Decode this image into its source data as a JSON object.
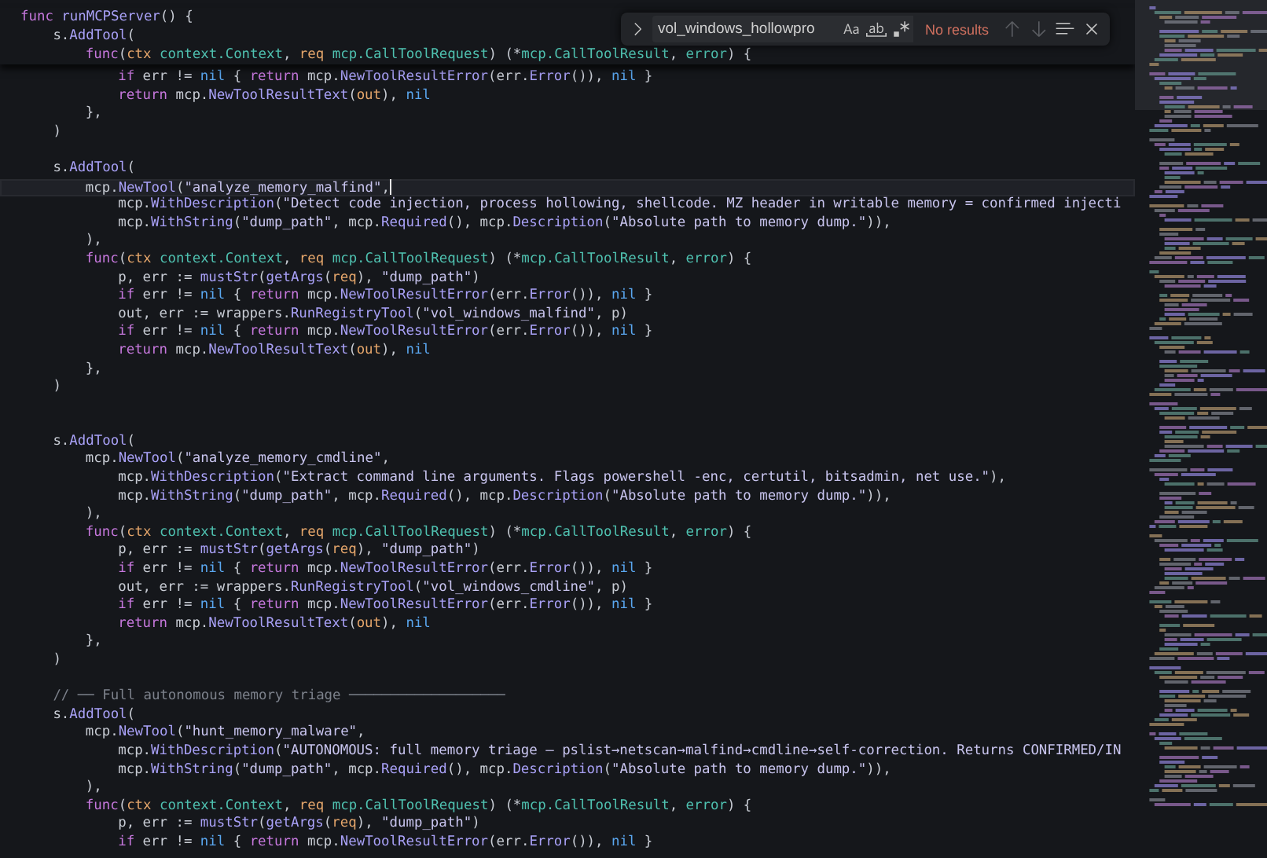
{
  "sticky_lines": [
    {
      "tokens": [
        {
          "kind": "kw",
          "text": "func"
        },
        {
          "kind": "fn",
          "text": " runMCPServer"
        },
        {
          "kind": "plain",
          "text": "() {"
        }
      ]
    },
    {
      "tokens": [
        {
          "kind": "plain",
          "text": "\ts."
        },
        {
          "kind": "fn",
          "text": "AddTool"
        },
        {
          "kind": "plain",
          "text": "("
        }
      ]
    },
    {
      "tokens": [
        {
          "kind": "kw",
          "text": "\t\tfunc"
        },
        {
          "kind": "plain",
          "text": "("
        },
        {
          "kind": "var",
          "text": "ctx"
        },
        {
          "kind": "type",
          "text": " context.Context"
        },
        {
          "kind": "plain",
          "text": ", "
        },
        {
          "kind": "var",
          "text": "req"
        },
        {
          "kind": "type",
          "text": " mcp.CallToolRequest"
        },
        {
          "kind": "plain",
          "text": ") (*"
        },
        {
          "kind": "type",
          "text": "mcp.CallToolResult"
        },
        {
          "kind": "plain",
          "text": ", "
        },
        {
          "kind": "type",
          "text": "error"
        },
        {
          "kind": "plain",
          "text": ") {"
        }
      ]
    }
  ],
  "lines": [
    {
      "current": false,
      "tokens": [
        {
          "kind": "kw",
          "text": "\t\t\tif"
        },
        {
          "kind": "plain",
          "text": " err != "
        },
        {
          "kind": "nil",
          "text": "nil"
        },
        {
          "kind": "plain",
          "text": " { "
        },
        {
          "kind": "kw",
          "text": "return"
        },
        {
          "kind": "plain",
          "text": " mcp."
        },
        {
          "kind": "fn",
          "text": "NewToolResultError"
        },
        {
          "kind": "plain",
          "text": "(err."
        },
        {
          "kind": "fn",
          "text": "Error"
        },
        {
          "kind": "plain",
          "text": "()), "
        },
        {
          "kind": "nil",
          "text": "nil"
        },
        {
          "kind": "plain",
          "text": " }"
        }
      ]
    },
    {
      "current": false,
      "tokens": [
        {
          "kind": "kw",
          "text": "\t\t\treturn"
        },
        {
          "kind": "plain",
          "text": " mcp."
        },
        {
          "kind": "fn",
          "text": "NewToolResultText"
        },
        {
          "kind": "plain",
          "text": "("
        },
        {
          "kind": "var",
          "text": "out"
        },
        {
          "kind": "plain",
          "text": "), "
        },
        {
          "kind": "nil",
          "text": "nil"
        }
      ]
    },
    {
      "current": false,
      "tokens": [
        {
          "kind": "plain",
          "text": "\t\t},"
        }
      ]
    },
    {
      "current": false,
      "tokens": [
        {
          "kind": "plain",
          "text": "\t)"
        }
      ]
    },
    {
      "current": false
    },
    {
      "current": false,
      "tokens": [
        {
          "kind": "plain",
          "text": "\ts."
        },
        {
          "kind": "fn",
          "text": "AddTool"
        },
        {
          "kind": "plain",
          "text": "("
        }
      ]
    },
    {
      "current": true,
      "tokens": [
        {
          "kind": "plain",
          "text": "\t\tmcp."
        },
        {
          "kind": "fn",
          "text": "NewTool"
        },
        {
          "kind": "plain",
          "text": "("
        },
        {
          "kind": "str",
          "text": "\"analyze_memory_malfind\""
        },
        {
          "kind": "plain",
          "text": ","
        }
      ]
    },
    {
      "current": false,
      "tokens": [
        {
          "kind": "plain",
          "text": "\t\t\tmcp."
        },
        {
          "kind": "fn",
          "text": "WithDescription"
        },
        {
          "kind": "plain",
          "text": "("
        },
        {
          "kind": "str",
          "text": "\"Detect code injection, process hollowing, shellcode. MZ header in writable memory = confirmed injecti"
        }
      ]
    },
    {
      "current": false,
      "tokens": [
        {
          "kind": "plain",
          "text": "\t\t\tmcp."
        },
        {
          "kind": "fn",
          "text": "WithString"
        },
        {
          "kind": "plain",
          "text": "("
        },
        {
          "kind": "str",
          "text": "\"dump_path\""
        },
        {
          "kind": "plain",
          "text": ", mcp."
        },
        {
          "kind": "fn",
          "text": "Required"
        },
        {
          "kind": "plain",
          "text": "(), mcp."
        },
        {
          "kind": "fn",
          "text": "Description"
        },
        {
          "kind": "plain",
          "text": "("
        },
        {
          "kind": "str",
          "text": "\"Absolute path to memory dump.\""
        },
        {
          "kind": "plain",
          "text": ")),"
        }
      ]
    },
    {
      "current": false,
      "tokens": [
        {
          "kind": "plain",
          "text": "\t\t),"
        }
      ]
    },
    {
      "current": false,
      "tokens": [
        {
          "kind": "kw",
          "text": "\t\tfunc"
        },
        {
          "kind": "plain",
          "text": "("
        },
        {
          "kind": "var",
          "text": "ctx"
        },
        {
          "kind": "type",
          "text": " context.Context"
        },
        {
          "kind": "plain",
          "text": ", "
        },
        {
          "kind": "var",
          "text": "req"
        },
        {
          "kind": "type",
          "text": " mcp.CallToolRequest"
        },
        {
          "kind": "plain",
          "text": ") (*"
        },
        {
          "kind": "type",
          "text": "mcp.CallToolResult"
        },
        {
          "kind": "plain",
          "text": ", "
        },
        {
          "kind": "type",
          "text": "error"
        },
        {
          "kind": "plain",
          "text": ") {"
        }
      ]
    },
    {
      "current": false,
      "tokens": [
        {
          "kind": "plain",
          "text": "\t\t\tp, err := "
        },
        {
          "kind": "fn",
          "text": "mustStr"
        },
        {
          "kind": "plain",
          "text": "("
        },
        {
          "kind": "fn",
          "text": "getArgs"
        },
        {
          "kind": "plain",
          "text": "("
        },
        {
          "kind": "var",
          "text": "req"
        },
        {
          "kind": "plain",
          "text": "), "
        },
        {
          "kind": "str",
          "text": "\"dump_path\""
        },
        {
          "kind": "plain",
          "text": ")"
        }
      ]
    },
    {
      "current": false,
      "tokens": [
        {
          "kind": "kw",
          "text": "\t\t\tif"
        },
        {
          "kind": "plain",
          "text": " err != "
        },
        {
          "kind": "nil",
          "text": "nil"
        },
        {
          "kind": "plain",
          "text": " { "
        },
        {
          "kind": "kw",
          "text": "return"
        },
        {
          "kind": "plain",
          "text": " mcp."
        },
        {
          "kind": "fn",
          "text": "NewToolResultError"
        },
        {
          "kind": "plain",
          "text": "(err."
        },
        {
          "kind": "fn",
          "text": "Error"
        },
        {
          "kind": "plain",
          "text": "()), "
        },
        {
          "kind": "nil",
          "text": "nil"
        },
        {
          "kind": "plain",
          "text": " }"
        }
      ]
    },
    {
      "current": false,
      "tokens": [
        {
          "kind": "plain",
          "text": "\t\t\tout, err := wrappers."
        },
        {
          "kind": "fn",
          "text": "RunRegistryTool"
        },
        {
          "kind": "plain",
          "text": "("
        },
        {
          "kind": "str",
          "text": "\"vol_windows_malfind\""
        },
        {
          "kind": "plain",
          "text": ", p)"
        }
      ]
    },
    {
      "current": false,
      "tokens": [
        {
          "kind": "kw",
          "text": "\t\t\tif"
        },
        {
          "kind": "plain",
          "text": " err != "
        },
        {
          "kind": "nil",
          "text": "nil"
        },
        {
          "kind": "plain",
          "text": " { "
        },
        {
          "kind": "kw",
          "text": "return"
        },
        {
          "kind": "plain",
          "text": " mcp."
        },
        {
          "kind": "fn",
          "text": "NewToolResultError"
        },
        {
          "kind": "plain",
          "text": "(err."
        },
        {
          "kind": "fn",
          "text": "Error"
        },
        {
          "kind": "plain",
          "text": "()), "
        },
        {
          "kind": "nil",
          "text": "nil"
        },
        {
          "kind": "plain",
          "text": " }"
        }
      ]
    },
    {
      "current": false,
      "tokens": [
        {
          "kind": "kw",
          "text": "\t\t\treturn"
        },
        {
          "kind": "plain",
          "text": " mcp."
        },
        {
          "kind": "fn",
          "text": "NewToolResultText"
        },
        {
          "kind": "plain",
          "text": "("
        },
        {
          "kind": "var",
          "text": "out"
        },
        {
          "kind": "plain",
          "text": "), "
        },
        {
          "kind": "nil",
          "text": "nil"
        }
      ]
    },
    {
      "current": false,
      "tokens": [
        {
          "kind": "plain",
          "text": "\t\t},"
        }
      ]
    },
    {
      "current": false,
      "tokens": [
        {
          "kind": "plain",
          "text": "\t)"
        }
      ]
    },
    {
      "current": false
    },
    {
      "current": false
    },
    {
      "current": false,
      "tokens": [
        {
          "kind": "plain",
          "text": "\ts."
        },
        {
          "kind": "fn",
          "text": "AddTool"
        },
        {
          "kind": "plain",
          "text": "("
        }
      ]
    },
    {
      "current": false,
      "tokens": [
        {
          "kind": "plain",
          "text": "\t\tmcp."
        },
        {
          "kind": "fn",
          "text": "NewTool"
        },
        {
          "kind": "plain",
          "text": "("
        },
        {
          "kind": "str",
          "text": "\"analyze_memory_cmdline\""
        },
        {
          "kind": "plain",
          "text": ","
        }
      ]
    },
    {
      "current": false,
      "tokens": [
        {
          "kind": "plain",
          "text": "\t\t\tmcp."
        },
        {
          "kind": "fn",
          "text": "WithDescription"
        },
        {
          "kind": "plain",
          "text": "("
        },
        {
          "kind": "str",
          "text": "\"Extract command line arguments. Flags powershell -enc, certutil, bitsadmin, net use.\""
        },
        {
          "kind": "plain",
          "text": "),"
        }
      ]
    },
    {
      "current": false,
      "tokens": [
        {
          "kind": "plain",
          "text": "\t\t\tmcp."
        },
        {
          "kind": "fn",
          "text": "WithString"
        },
        {
          "kind": "plain",
          "text": "("
        },
        {
          "kind": "str",
          "text": "\"dump_path\""
        },
        {
          "kind": "plain",
          "text": ", mcp."
        },
        {
          "kind": "fn",
          "text": "Required"
        },
        {
          "kind": "plain",
          "text": "(), mcp."
        },
        {
          "kind": "fn",
          "text": "Description"
        },
        {
          "kind": "plain",
          "text": "("
        },
        {
          "kind": "str",
          "text": "\"Absolute path to memory dump.\""
        },
        {
          "kind": "plain",
          "text": ")),"
        }
      ]
    },
    {
      "current": false,
      "tokens": [
        {
          "kind": "plain",
          "text": "\t\t),"
        }
      ]
    },
    {
      "current": false,
      "tokens": [
        {
          "kind": "kw",
          "text": "\t\tfunc"
        },
        {
          "kind": "plain",
          "text": "("
        },
        {
          "kind": "var",
          "text": "ctx"
        },
        {
          "kind": "type",
          "text": " context.Context"
        },
        {
          "kind": "plain",
          "text": ", "
        },
        {
          "kind": "var",
          "text": "req"
        },
        {
          "kind": "type",
          "text": " mcp.CallToolRequest"
        },
        {
          "kind": "plain",
          "text": ") (*"
        },
        {
          "kind": "type",
          "text": "mcp.CallToolResult"
        },
        {
          "kind": "plain",
          "text": ", "
        },
        {
          "kind": "type",
          "text": "error"
        },
        {
          "kind": "plain",
          "text": ") {"
        }
      ]
    },
    {
      "current": false,
      "tokens": [
        {
          "kind": "plain",
          "text": "\t\t\tp, err := "
        },
        {
          "kind": "fn",
          "text": "mustStr"
        },
        {
          "kind": "plain",
          "text": "("
        },
        {
          "kind": "fn",
          "text": "getArgs"
        },
        {
          "kind": "plain",
          "text": "("
        },
        {
          "kind": "var",
          "text": "req"
        },
        {
          "kind": "plain",
          "text": "), "
        },
        {
          "kind": "str",
          "text": "\"dump_path\""
        },
        {
          "kind": "plain",
          "text": ")"
        }
      ]
    },
    {
      "current": false,
      "tokens": [
        {
          "kind": "kw",
          "text": "\t\t\tif"
        },
        {
          "kind": "plain",
          "text": " err != "
        },
        {
          "kind": "nil",
          "text": "nil"
        },
        {
          "kind": "plain",
          "text": " { "
        },
        {
          "kind": "kw",
          "text": "return"
        },
        {
          "kind": "plain",
          "text": " mcp."
        },
        {
          "kind": "fn",
          "text": "NewToolResultError"
        },
        {
          "kind": "plain",
          "text": "(err."
        },
        {
          "kind": "fn",
          "text": "Error"
        },
        {
          "kind": "plain",
          "text": "()), "
        },
        {
          "kind": "nil",
          "text": "nil"
        },
        {
          "kind": "plain",
          "text": " }"
        }
      ]
    },
    {
      "current": false,
      "tokens": [
        {
          "kind": "plain",
          "text": "\t\t\tout, err := wrappers."
        },
        {
          "kind": "fn",
          "text": "RunRegistryTool"
        },
        {
          "kind": "plain",
          "text": "("
        },
        {
          "kind": "str",
          "text": "\"vol_windows_cmdline\""
        },
        {
          "kind": "plain",
          "text": ", p)"
        }
      ]
    },
    {
      "current": false,
      "tokens": [
        {
          "kind": "kw",
          "text": "\t\t\tif"
        },
        {
          "kind": "plain",
          "text": " err != "
        },
        {
          "kind": "nil",
          "text": "nil"
        },
        {
          "kind": "plain",
          "text": " { "
        },
        {
          "kind": "kw",
          "text": "return"
        },
        {
          "kind": "plain",
          "text": " mcp."
        },
        {
          "kind": "fn",
          "text": "NewToolResultError"
        },
        {
          "kind": "plain",
          "text": "(err."
        },
        {
          "kind": "fn",
          "text": "Error"
        },
        {
          "kind": "plain",
          "text": "()), "
        },
        {
          "kind": "nil",
          "text": "nil"
        },
        {
          "kind": "plain",
          "text": " }"
        }
      ]
    },
    {
      "current": false,
      "tokens": [
        {
          "kind": "kw",
          "text": "\t\t\treturn"
        },
        {
          "kind": "plain",
          "text": " mcp."
        },
        {
          "kind": "fn",
          "text": "NewToolResultText"
        },
        {
          "kind": "plain",
          "text": "("
        },
        {
          "kind": "var",
          "text": "out"
        },
        {
          "kind": "plain",
          "text": "), "
        },
        {
          "kind": "nil",
          "text": "nil"
        }
      ]
    },
    {
      "current": false,
      "tokens": [
        {
          "kind": "plain",
          "text": "\t\t},"
        }
      ]
    },
    {
      "current": false,
      "tokens": [
        {
          "kind": "plain",
          "text": "\t)"
        }
      ]
    },
    {
      "current": false
    },
    {
      "current": false,
      "tokens": [
        {
          "kind": "comment",
          "text": "\t// ── Full autonomous memory triage ───────────────────"
        }
      ]
    },
    {
      "current": false,
      "tokens": [
        {
          "kind": "plain",
          "text": "\ts."
        },
        {
          "kind": "fn",
          "text": "AddTool"
        },
        {
          "kind": "plain",
          "text": "("
        }
      ]
    },
    {
      "current": false,
      "tokens": [
        {
          "kind": "plain",
          "text": "\t\tmcp."
        },
        {
          "kind": "fn",
          "text": "NewTool"
        },
        {
          "kind": "plain",
          "text": "("
        },
        {
          "kind": "str",
          "text": "\"hunt_memory_malware\""
        },
        {
          "kind": "plain",
          "text": ","
        }
      ]
    },
    {
      "current": false,
      "tokens": [
        {
          "kind": "plain",
          "text": "\t\t\tmcp."
        },
        {
          "kind": "fn",
          "text": "WithDescription"
        },
        {
          "kind": "plain",
          "text": "("
        },
        {
          "kind": "str",
          "text": "\"AUTONOMOUS: full memory triage — pslist→netscan→malfind→cmdline→self-correction. Returns CONFIRMED/IN"
        }
      ]
    },
    {
      "current": false,
      "tokens": [
        {
          "kind": "plain",
          "text": "\t\t\tmcp."
        },
        {
          "kind": "fn",
          "text": "WithString"
        },
        {
          "kind": "plain",
          "text": "("
        },
        {
          "kind": "str",
          "text": "\"dump_path\""
        },
        {
          "kind": "plain",
          "text": ", mcp."
        },
        {
          "kind": "fn",
          "text": "Required"
        },
        {
          "kind": "plain",
          "text": "(), mcp."
        },
        {
          "kind": "fn",
          "text": "Description"
        },
        {
          "kind": "plain",
          "text": "("
        },
        {
          "kind": "str",
          "text": "\"Absolute path to memory dump.\""
        },
        {
          "kind": "plain",
          "text": ")),"
        }
      ]
    },
    {
      "current": false,
      "tokens": [
        {
          "kind": "plain",
          "text": "\t\t),"
        }
      ]
    },
    {
      "current": false,
      "tokens": [
        {
          "kind": "kw",
          "text": "\t\tfunc"
        },
        {
          "kind": "plain",
          "text": "("
        },
        {
          "kind": "var",
          "text": "ctx"
        },
        {
          "kind": "type",
          "text": " context.Context"
        },
        {
          "kind": "plain",
          "text": ", "
        },
        {
          "kind": "var",
          "text": "req"
        },
        {
          "kind": "type",
          "text": " mcp.CallToolRequest"
        },
        {
          "kind": "plain",
          "text": ") (*"
        },
        {
          "kind": "type",
          "text": "mcp.CallToolResult"
        },
        {
          "kind": "plain",
          "text": ", "
        },
        {
          "kind": "type",
          "text": "error"
        },
        {
          "kind": "plain",
          "text": ") {"
        }
      ]
    },
    {
      "current": false,
      "tokens": [
        {
          "kind": "plain",
          "text": "\t\t\tp, err := "
        },
        {
          "kind": "fn",
          "text": "mustStr"
        },
        {
          "kind": "plain",
          "text": "("
        },
        {
          "kind": "fn",
          "text": "getArgs"
        },
        {
          "kind": "plain",
          "text": "("
        },
        {
          "kind": "var",
          "text": "req"
        },
        {
          "kind": "plain",
          "text": "), "
        },
        {
          "kind": "str",
          "text": "\"dump_path\""
        },
        {
          "kind": "plain",
          "text": ")"
        }
      ]
    },
    {
      "current": false,
      "tokens": [
        {
          "kind": "kw",
          "text": "\t\t\tif"
        },
        {
          "kind": "plain",
          "text": " err != "
        },
        {
          "kind": "nil",
          "text": "nil"
        },
        {
          "kind": "plain",
          "text": " { "
        },
        {
          "kind": "kw",
          "text": "return"
        },
        {
          "kind": "plain",
          "text": " mcp."
        },
        {
          "kind": "fn",
          "text": "NewToolResultError"
        },
        {
          "kind": "plain",
          "text": "(err."
        },
        {
          "kind": "fn",
          "text": "Error"
        },
        {
          "kind": "plain",
          "text": "()), "
        },
        {
          "kind": "nil",
          "text": "nil"
        },
        {
          "kind": "plain",
          "text": " }"
        }
      ]
    }
  ],
  "find_widget": {
    "query": "vol_windows_hollowpro",
    "toggles": [
      {
        "kind": "match_case",
        "on": false
      },
      {
        "kind": "whole_word",
        "on": false
      },
      {
        "kind": "regex",
        "on": false
      }
    ],
    "result": "No results",
    "nav_disabled": true
  }
}
